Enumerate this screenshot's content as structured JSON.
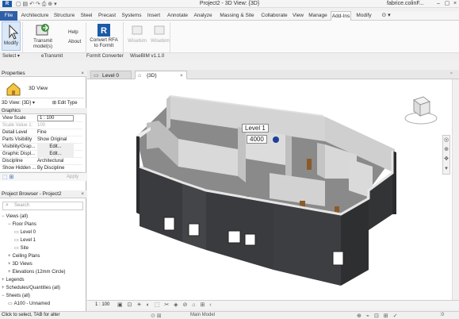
{
  "app": {
    "title": "Project2 - 3D View: {3D}",
    "user": "fabrice.colinF..."
  },
  "ribbon_tabs": [
    "File",
    "Architecture",
    "Structure",
    "Steel",
    "Precast",
    "Systems",
    "Insert",
    "Annotate",
    "Analyze",
    "Massing & Site",
    "Collaborate",
    "View",
    "Manage",
    "Add-Ins",
    "Modify"
  ],
  "active_tab": "Add-Ins",
  "ribbon": {
    "modify": "Modify",
    "transmit": "Transmit model(s)",
    "help": "Help",
    "about": "About",
    "convert_line1": "Convert RFA",
    "convert_line2": "to FormIt",
    "wisebim1": "Wisebim",
    "wisebim2": "Wisebim",
    "group_select": "Select",
    "group_etransmit": "eTransmit",
    "group_formit": "FormIt Converter",
    "group_wisebim": "WiseBIM v1.1.0"
  },
  "properties": {
    "panel_title": "Properties",
    "type_name": "3D View",
    "instance_selector": "3D View: {3D}",
    "edit_type": "Edit Type",
    "section": "Graphics",
    "rows": [
      {
        "key": "View Scale",
        "value": "1 : 100",
        "dim": false
      },
      {
        "key": "Scale Value 1:",
        "value": "100",
        "dim": true
      },
      {
        "key": "Detail Level",
        "value": "Fine",
        "dim": false
      },
      {
        "key": "Parts Visibility",
        "value": "Show Original",
        "dim": false
      },
      {
        "key": "Visibility/Grap...",
        "value": "Edit...",
        "dim": false
      },
      {
        "key": "Graphic Displ...",
        "value": "Edit...",
        "dim": false
      },
      {
        "key": "Discipline",
        "value": "Architectural",
        "dim": false
      },
      {
        "key": "Show Hidden ...",
        "value": "By Discipline",
        "dim": false
      }
    ],
    "apply": "Apply"
  },
  "browser": {
    "title": "Project Browser - Project2",
    "search_placeholder": "Search",
    "items": [
      {
        "label": "Views (all)",
        "indent": 1,
        "sign": "−"
      },
      {
        "label": "Floor Plans",
        "indent": 2,
        "sign": "−"
      },
      {
        "label": "Level 0",
        "indent": 3,
        "sign": ""
      },
      {
        "label": "Level 1",
        "indent": 3,
        "sign": ""
      },
      {
        "label": "Site",
        "indent": 3,
        "sign": ""
      },
      {
        "label": "Ceiling Plans",
        "indent": 2,
        "sign": "+"
      },
      {
        "label": "3D Views",
        "indent": 2,
        "sign": "+"
      },
      {
        "label": "Elevations (12mm Circle)",
        "indent": 2,
        "sign": "+"
      },
      {
        "label": "Legends",
        "indent": 1,
        "sign": "+"
      },
      {
        "label": "Schedules/Quantities (all)",
        "indent": 1,
        "sign": "+"
      },
      {
        "label": "Sheets (all)",
        "indent": 1,
        "sign": "−"
      },
      {
        "label": "A100 - Unnamed",
        "indent": 2,
        "sign": ""
      }
    ]
  },
  "view_tabs": [
    {
      "label": "Level 0",
      "active": false
    },
    {
      "label": "{3D}",
      "active": true
    }
  ],
  "viewport": {
    "level_label": "Level 1",
    "level_value": "4000"
  },
  "status": {
    "scale": "1 : 100",
    "hint": "Click to select, TAB for alter",
    "model": "Main Model",
    "filter_count": ":0"
  },
  "colors": {
    "file_tab": "#2f5fa7",
    "wall_dark": "#3a3b3e",
    "wall_top": "#d8d8d8",
    "floor": "#8a8a8a",
    "door": "#8b5a2b"
  }
}
